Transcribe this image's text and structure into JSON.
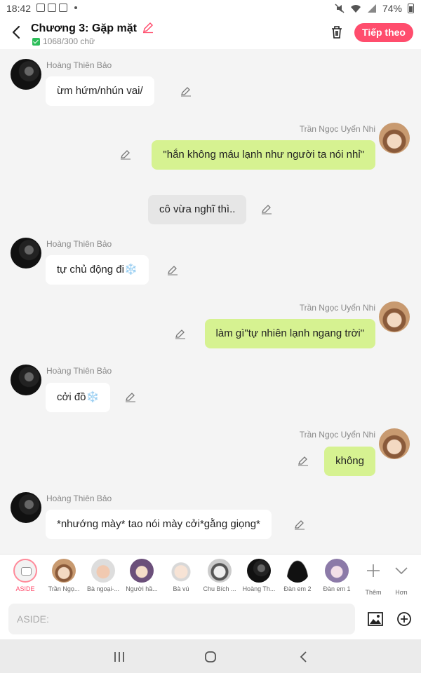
{
  "status_bar": {
    "time": "18:42",
    "battery": "74%"
  },
  "header": {
    "title": "Chương 3: Gặp mặt",
    "word_count": "1068/300 chữ",
    "follow_label": "Tiếp theo",
    "accent_color": "#ff4d6d"
  },
  "messages": [
    {
      "side": "left",
      "sender": "Hoàng Thiên Bảo",
      "text": "ừm hứm/nhún vai/"
    },
    {
      "side": "right",
      "sender": "Trần Ngọc Uyển Nhi",
      "text": "\"hắn không máu lạnh như người ta nói nhỉ\""
    },
    {
      "side": "center",
      "text": "cô vừa nghĩ thì.."
    },
    {
      "side": "left",
      "sender": "Hoàng Thiên Bảo",
      "text": "tự chủ động đi❄️"
    },
    {
      "side": "right",
      "sender": "Trần Ngọc Uyển Nhi",
      "text": "làm gì\"tự nhiên lạnh ngang trời\""
    },
    {
      "side": "left",
      "sender": "Hoàng Thiên Bảo",
      "text": "cởi đồ❄️"
    },
    {
      "side": "right",
      "sender": "Trần Ngọc Uyển Nhi",
      "text": "không"
    },
    {
      "side": "left",
      "sender": "Hoàng Thiên Bảo",
      "text": "*nhướng mày* tao nói mày cởi*gằng giọng*"
    }
  ],
  "characters": [
    {
      "name": "ASIDE",
      "icon": "aside-icon"
    },
    {
      "name": "Trần Ngọ...",
      "icon": "avatar"
    },
    {
      "name": "Bà ngoại-...",
      "icon": "avatar"
    },
    {
      "name": "Người hầ...",
      "icon": "avatar"
    },
    {
      "name": "Bà vú",
      "icon": "avatar"
    },
    {
      "name": "Chu Bích ...",
      "icon": "avatar"
    },
    {
      "name": "Hoàng Th...",
      "icon": "avatar"
    },
    {
      "name": "Đàn em 2",
      "icon": "avatar"
    },
    {
      "name": "Đàn em 1",
      "icon": "avatar"
    }
  ],
  "more_label": "Thêm",
  "collapse_label": "Hơn",
  "input": {
    "placeholder": "ASIDE:"
  },
  "colors": {
    "right_bubble": "#d6f291",
    "left_bubble": "#ffffff",
    "aside_bubble": "#e6e6e6"
  }
}
